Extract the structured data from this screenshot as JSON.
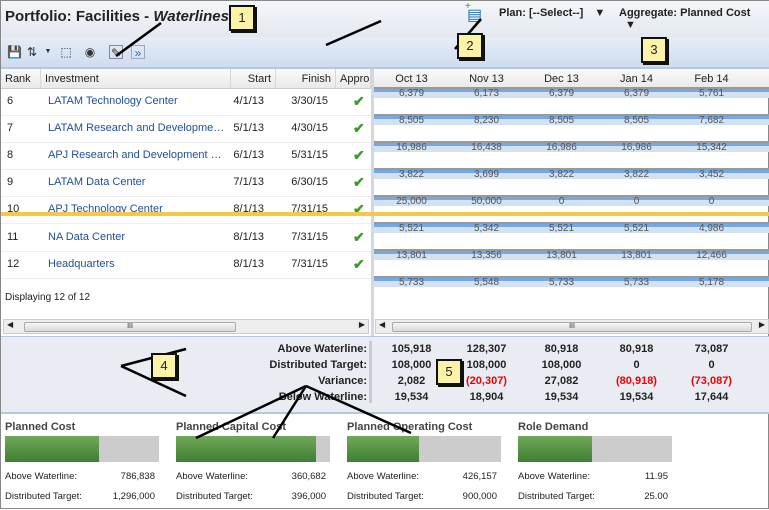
{
  "title": {
    "prefix": "Portfolio: Facilities - ",
    "italic": "Waterlines"
  },
  "header": {
    "plan_label": "Plan: [--Select--]",
    "aggregate_label": "Aggregate: Planned Cost"
  },
  "toolbar": {
    "icons": [
      "save-icon",
      "sort-icon",
      "dropdown-icon",
      "select-icon",
      "view-icon",
      "filter-icon",
      "expand-icon"
    ]
  },
  "grid": {
    "columns": [
      "Rank",
      "Investment",
      "Start",
      "Finish",
      "Appro"
    ],
    "rows": [
      {
        "rank": "6",
        "investment": "LATAM Technology Center",
        "start": "4/1/13",
        "finish": "3/30/15",
        "approved": true
      },
      {
        "rank": "7",
        "investment": "LATAM Research and Development...",
        "start": "5/1/13",
        "finish": "4/30/15",
        "approved": true
      },
      {
        "rank": "8",
        "investment": "APJ Research and Development Center",
        "start": "6/1/13",
        "finish": "5/31/15",
        "approved": true
      },
      {
        "rank": "9",
        "investment": "LATAM Data Center",
        "start": "7/1/13",
        "finish": "6/30/15",
        "approved": true
      },
      {
        "rank": "10",
        "investment": "APJ Technology Center",
        "start": "8/1/13",
        "finish": "7/31/15",
        "approved": true
      },
      {
        "rank": "11",
        "investment": "NA Data Center",
        "start": "8/1/13",
        "finish": "7/31/15",
        "approved": true
      },
      {
        "rank": "12",
        "investment": "Headquarters",
        "start": "8/1/13",
        "finish": "7/31/15",
        "approved": true
      }
    ],
    "status": "Displaying 12 of 12"
  },
  "timeline": {
    "months": [
      "Oct 13",
      "Nov 13",
      "Dec 13",
      "Jan 14",
      "Feb 14"
    ],
    "values": [
      [
        "6,379",
        "6,173",
        "6,379",
        "6,379",
        "5,761"
      ],
      [
        "8,505",
        "8,230",
        "8,505",
        "8,505",
        "7,682"
      ],
      [
        "16,986",
        "16,438",
        "16,986",
        "16,986",
        "15,342"
      ],
      [
        "3,822",
        "3,699",
        "3,822",
        "3,822",
        "3,452"
      ],
      [
        "25,000",
        "50,000",
        "0",
        "0",
        "0"
      ],
      [
        "5,521",
        "5,342",
        "5,521",
        "5,521",
        "4,986"
      ],
      [
        "13,801",
        "13,356",
        "13,801",
        "13,801",
        "12,466"
      ],
      [
        "5,733",
        "5,548",
        "5,733",
        "5,733",
        "5,178"
      ]
    ]
  },
  "summary": {
    "labels": [
      "Above Waterline:",
      "Distributed Target:",
      "Variance:",
      "Below Waterline:"
    ],
    "rows": [
      [
        "105,918",
        "128,307",
        "80,918",
        "80,918",
        "73,087"
      ],
      [
        "108,000",
        "108,000",
        "108,000",
        "0",
        "0"
      ],
      [
        "2,082",
        "(20,307)",
        "27,082",
        "(80,918)",
        "(73,087)"
      ],
      [
        "19,534",
        "18,904",
        "19,534",
        "19,534",
        "17,644"
      ]
    ]
  },
  "panels": [
    {
      "title": "Planned Cost",
      "fill_percent": 61,
      "above_label": "Above Waterline:",
      "above": "786,838",
      "target_label": "Distributed Target:",
      "target": "1,296,000"
    },
    {
      "title": "Planned Capital Cost",
      "fill_percent": 91,
      "above_label": "Above Waterline:",
      "above": "360,682",
      "target_label": "Distributed Target:",
      "target": "396,000"
    },
    {
      "title": "Planned Operating Cost",
      "fill_percent": 47,
      "above_label": "Above Waterline:",
      "above": "426,157",
      "target_label": "Distributed Target:",
      "target": "900,000"
    },
    {
      "title": "Role Demand",
      "fill_percent": 48,
      "above_label": "Above Waterline:",
      "above": "11.95",
      "target_label": "Distributed Target:",
      "target": "25.00"
    }
  ],
  "callouts": [
    "1",
    "2",
    "3",
    "4",
    "5"
  ],
  "colors": {
    "accent": "#1f4f99",
    "waterline": "#f5c84c",
    "negative": "#e00000",
    "bar_fill": "#4f8f3f",
    "check": "#3a9a2a"
  }
}
